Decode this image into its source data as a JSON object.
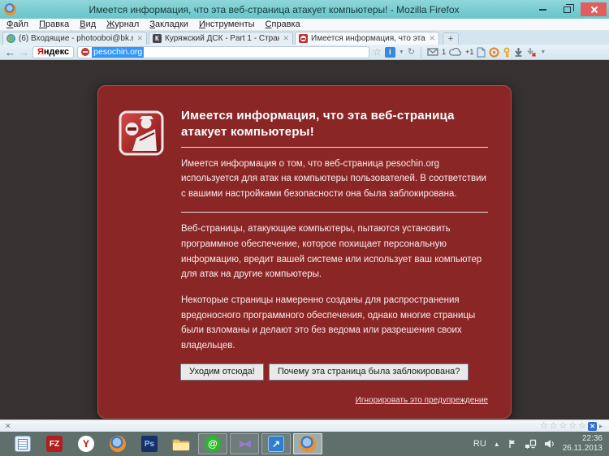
{
  "window": {
    "title": "Имеется информация, что эта веб-страница атакует компьютеры! - Mozilla Firefox"
  },
  "menu": {
    "items": [
      "Файл",
      "Правка",
      "Вид",
      "Журнал",
      "Закладки",
      "Инструменты",
      "Справка"
    ]
  },
  "tabbar": {
    "tabs": [
      {
        "label": "(6) Входящие - photooboi@bk.ru - П...",
        "icon": "mailru-icon",
        "active": false
      },
      {
        "label": "Куряжский ДСК - Part 1 - Страница ...",
        "icon": "forum-icon",
        "active": false
      },
      {
        "label": "Имеется информация, что эта веб-...",
        "icon": "attack-warning-icon",
        "active": true
      }
    ],
    "new_tab_label": "+"
  },
  "navbar": {
    "yandex_logo": "Яндекс",
    "url": "pesochin.org",
    "mail_badge": "1",
    "cloud_badge": "+1"
  },
  "page": {
    "title": "Имеется информация, что эта веб-страница атакует компьютеры!",
    "para_blocked": "Имеется информация о том, что веб-страница pesochin.org используется для атак на компьютеры пользователей. В соответствии с вашими настройками безопасности она была заблокирована.",
    "para_explain1": "Веб-страницы, атакующие компьютеры, пытаются установить программное обеспечение, которое похищает персональную информацию, вредит вашей системе или использует ваш компьютер для атак на другие компьютеры.",
    "para_explain2": "Некоторые страницы намеренно созданы для распространения вредоносного программного обеспечения, однако многие страницы были взломаны и делают это без ведома или разрешения своих владельцев.",
    "btn_leave": "Уходим отсюда!",
    "btn_why": "Почему эта страница была заблокирована?",
    "ignore_link": "Игнорировать это предупреждение"
  },
  "tray": {
    "language": "RU",
    "time": "22:36",
    "date": "26.11.2013"
  },
  "colors": {
    "titlebar": "#67c5ca",
    "close_button": "#e25d5d",
    "page_background": "#373232",
    "dialog_background": "#8b2626",
    "url_selection": "#3297fd",
    "taskbar": "#5e6f6c"
  }
}
